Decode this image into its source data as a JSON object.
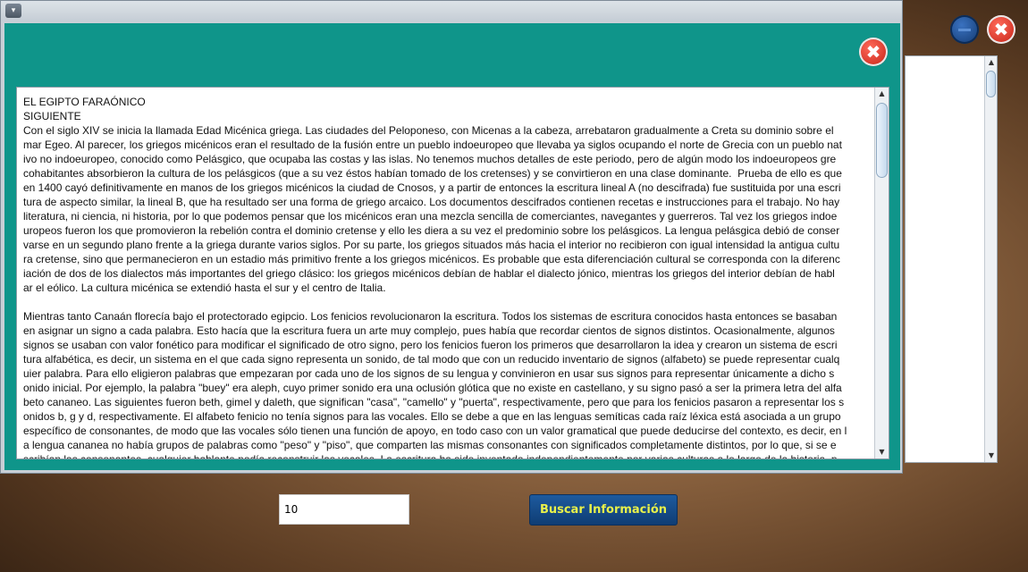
{
  "background_window": {
    "minimize_icon": "minimize-icon",
    "close_icon": "close-icon",
    "scroll_up": "▲",
    "scroll_down": "▼"
  },
  "search": {
    "input_value": "10",
    "button_label": "Buscar Información"
  },
  "dialog": {
    "menu_icon": "▾",
    "close_glyph": "✖",
    "scroll_up": "▲",
    "scroll_down": "▼",
    "lines": [
      "EL EGIPTO FARAÓNICO",
      "SIGUIENTE",
      "Con el siglo XIV se inicia la llamada Edad Micénica griega. Las ciudades del Peloponeso, con Micenas a la cabeza, arrebataron gradualmente a Creta su dominio sobre el",
      "mar Egeo. Al parecer, los griegos micénicos eran el resultado de la fusión entre un pueblo indoeuropeo que llevaba ya siglos ocupando el norte de Grecia con un pueblo nat",
      "ivo no indoeuropeo, conocido como Pelásgico, que ocupaba las costas y las islas. No tenemos muchos detalles de este periodo, pero de algún modo los indoeuropeos gre",
      "cohabitantes absorbieron la cultura de los pelásgicos (que a su vez éstos habían tomado de los cretenses) y se convirtieron en una clase dominante.  Prueba de ello es que",
      "en 1400 cayó definitivamente en manos de los griegos micénicos la ciudad de Cnosos, y a partir de entonces la escritura lineal A (no descifrada) fue sustituida por una escri",
      "tura de aspecto similar, la lineal B, que ha resultado ser una forma de griego arcaico. Los documentos descifrados contienen recetas e instrucciones para el trabajo. No hay",
      "literatura, ni ciencia, ni historia, por lo que podemos pensar que los micénicos eran una mezcla sencilla de comerciantes, navegantes y guerreros. Tal vez los griegos indoe",
      "uropeos fueron los que promovieron la rebelión contra el dominio cretense y ello les diera a su vez el predominio sobre los pelásgicos. La lengua pelásgica debió de conser",
      "varse en un segundo plano frente a la griega durante varios siglos. Por su parte, los griegos situados más hacia el interior no recibieron con igual intensidad la antigua cultu",
      "ra cretense, sino que permanecieron en un estadio más primitivo frente a los griegos micénicos. Es probable que esta diferenciación cultural se corresponda con la diferenc",
      "iación de dos de los dialectos más importantes del griego clásico: los griegos micénicos debían de hablar el dialecto jónico, mientras los griegos del interior debían de habl",
      "ar el eólico. La cultura micénica se extendió hasta el sur y el centro de Italia."
    ],
    "lines2": [
      "Mientras tanto Canaán florecía bajo el protectorado egipcio. Los fenicios revolucionaron la escritura. Todos los sistemas de escritura conocidos hasta entonces se basaban",
      "en asignar un signo a cada palabra. Esto hacía que la escritura fuera un arte muy complejo, pues había que recordar cientos de signos distintos. Ocasionalmente, algunos",
      "signos se usaban con valor fonético para modificar el significado de otro signo, pero los fenicios fueron los primeros que desarrollaron la idea y crearon un sistema de escri",
      "tura alfabética, es decir, un sistema en el que cada signo representa un sonido, de tal modo que con un reducido inventario de signos (alfabeto) se puede representar cualq",
      "uier palabra. Para ello eligieron palabras que empezaran por cada uno de los signos de su lengua y convinieron en usar sus signos para representar únicamente a dicho s",
      "onido inicial. Por ejemplo, la palabra \"buey\" era aleph, cuyo primer sonido era una oclusión glótica que no existe en castellano, y su signo pasó a ser la primera letra del alfa",
      "beto cananeo. Las siguientes fueron beth, gimel y daleth, que significan \"casa\", \"camello\" y \"puerta\", respectivamente, pero que para los fenicios pasaron a representar los s",
      "onidos b, g y d, respectivamente. El alfabeto fenicio no tenía signos para las vocales. Ello se debe a que en las lenguas semíticas cada raíz léxica está asociada a un grupo",
      "específico de consonantes, de modo que las vocales sólo tienen una función de apoyo, en todo caso con un valor gramatical que puede deducirse del contexto, es decir, en l",
      "a lengua cananea no había grupos de palabras como \"peso\" y \"piso\", que comparten las mismas consonantes con significados completamente distintos, por lo que, si se e",
      "scribían las consonantes, cualquier hablante podía reconstruir las vocales. La escritura ha sido inventada independientemente por varias culturas a lo largo de la historia, p"
    ]
  }
}
